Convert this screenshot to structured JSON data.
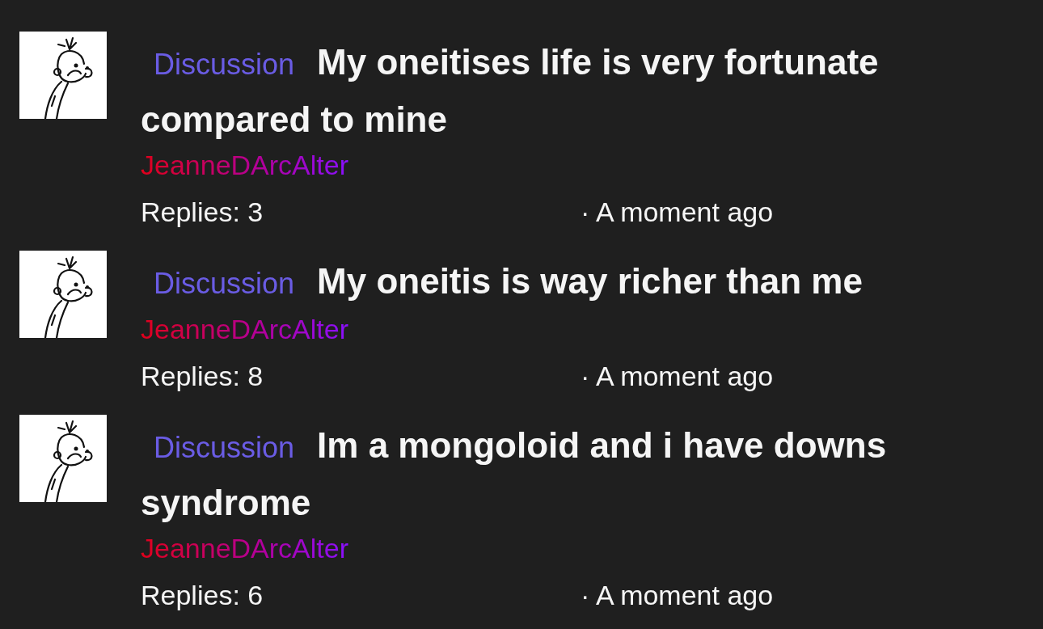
{
  "threads": [
    {
      "tag": "Discussion",
      "title": "My oneitises life is very fortunate compared to mine",
      "author": "JeanneDArcAlter",
      "replies": "Replies: 3",
      "time": "· A moment ago"
    },
    {
      "tag": "Discussion",
      "title": "My oneitis is way richer than me",
      "author": "JeanneDArcAlter",
      "replies": "Replies: 8",
      "time": "· A moment ago"
    },
    {
      "tag": "Discussion",
      "title": "Im a mongoloid and i have downs syndrome",
      "author": "JeanneDArcAlter",
      "replies": "Replies: 6",
      "time": "· A moment ago"
    }
  ]
}
